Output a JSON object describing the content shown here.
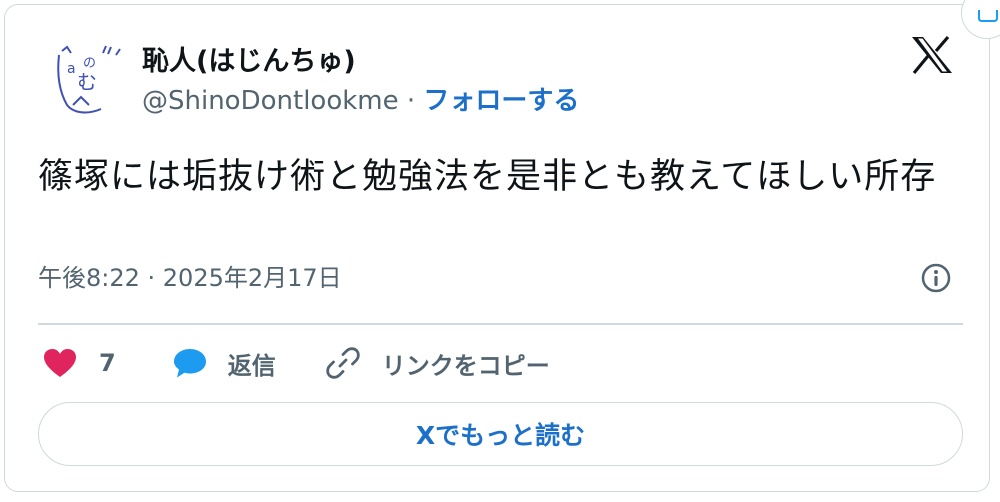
{
  "author": {
    "display_name": "恥人(はじんちゅ)",
    "handle": "@ShinoDontlookme",
    "separator": " · ",
    "follow_label": "フォローする"
  },
  "tweet": {
    "text": "篠塚には垢抜け術と勉強法を是非とも教えてほしい所存",
    "timestamp": "午後8:22 · 2025年2月17日"
  },
  "actions": {
    "like_count": "7",
    "reply_label": "返信",
    "copy_link_label": "リンクをコピー"
  },
  "read_more_label": "Xでもっと読む",
  "icons": {
    "brand": "x-logo-icon",
    "info": "info-icon",
    "like": "heart-icon",
    "reply": "speech-bubble-icon",
    "link": "link-icon"
  },
  "colors": {
    "link_blue": "#1d70c9",
    "like_pink": "#e0245e",
    "reply_blue": "#1d9bf0",
    "muted_text": "#536471",
    "border": "#cfd9de"
  }
}
